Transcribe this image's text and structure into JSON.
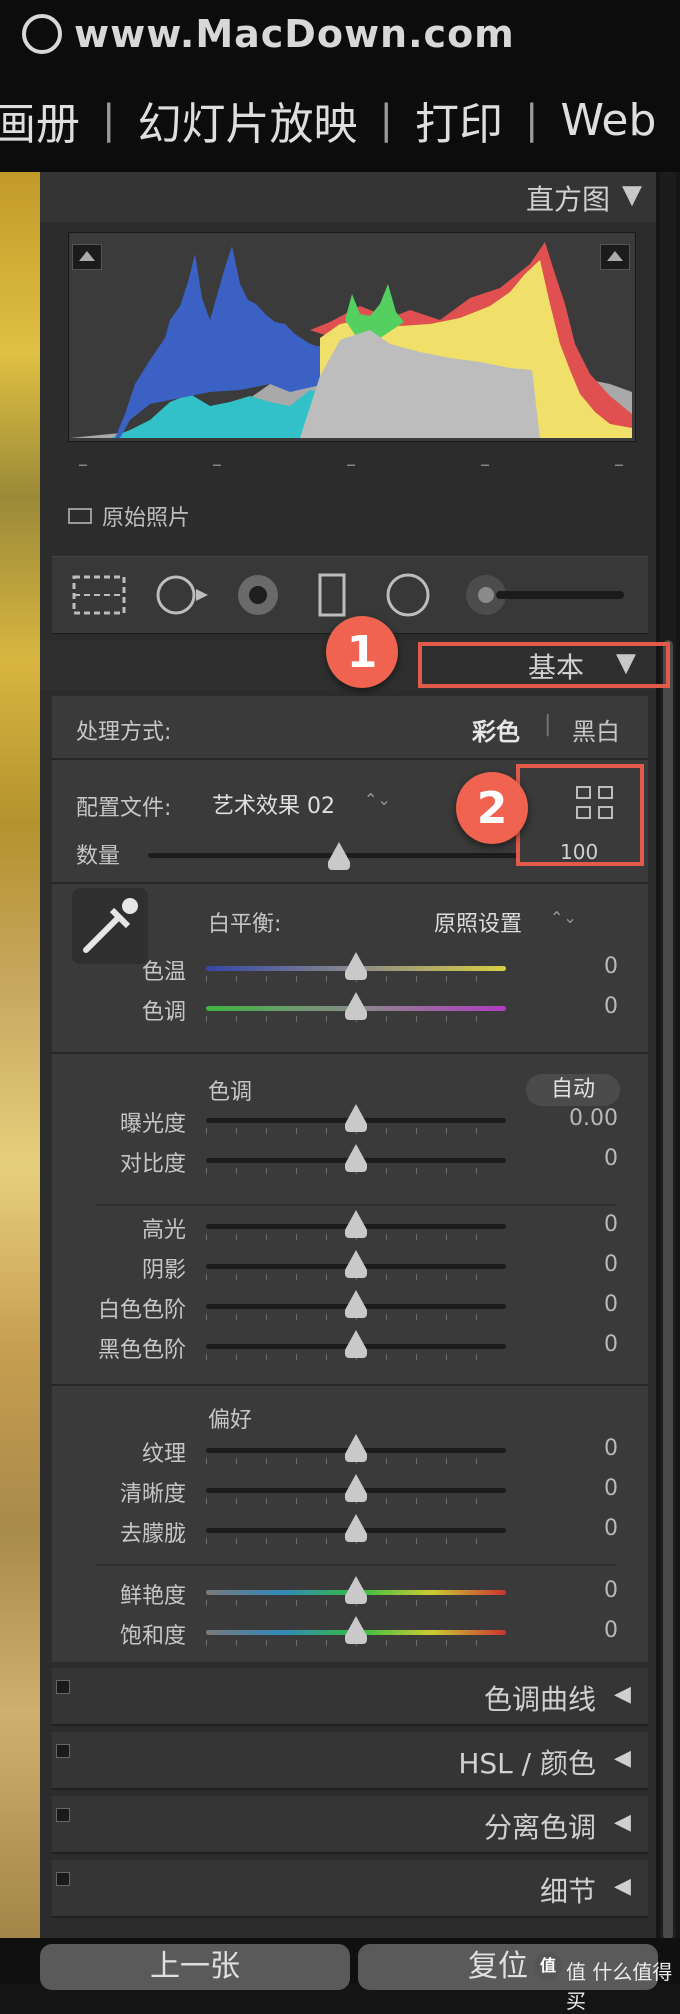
{
  "watermark": {
    "text": "www.MacDown.com"
  },
  "modules": [
    "画册",
    "幻灯片放映",
    "打印",
    "Web"
  ],
  "modules_sep": "|",
  "histogram": {
    "title": "直方图",
    "arrow": "▼",
    "ticks": [
      "–",
      "–",
      "–",
      "–",
      "–"
    ],
    "original_photo_label": "原始照片"
  },
  "tools": [
    "crop-overlay-icon",
    "spot-removal-icon",
    "red-eye-icon",
    "graduated-filter-icon",
    "radial-filter-icon",
    "adjustment-brush-icon"
  ],
  "basic": {
    "title": "基本",
    "arrow": "▼",
    "treatment_label": "处理方式:",
    "treatment_color": "彩色",
    "treatment_sep": "|",
    "treatment_bw": "黑白",
    "profile_label": "配置文件:",
    "profile_value": "艺术效果 02",
    "amount_label": "数量",
    "amount_value": "100",
    "wb_label": "白平衡:",
    "wb_value": "原照设置",
    "stepper": "⌃⌄",
    "tone_title": "色调",
    "auto_label": "自动",
    "presence_title": "偏好"
  },
  "sliders": [
    {
      "label": "色温",
      "value": "0",
      "track": "temp"
    },
    {
      "label": "色调",
      "value": "0",
      "track": "tint"
    },
    {
      "label": "曝光度",
      "value": "0.00",
      "track": "dark"
    },
    {
      "label": "对比度",
      "value": "0",
      "track": "dark"
    },
    {
      "label": "高光",
      "value": "0",
      "track": "dark"
    },
    {
      "label": "阴影",
      "value": "0",
      "track": "dark"
    },
    {
      "label": "白色色阶",
      "value": "0",
      "track": "dark"
    },
    {
      "label": "黑色色阶",
      "value": "0",
      "track": "dark"
    },
    {
      "label": "纹理",
      "value": "0",
      "track": "dark"
    },
    {
      "label": "清晰度",
      "value": "0",
      "track": "dark"
    },
    {
      "label": "去朦胧",
      "value": "0",
      "track": "dark"
    },
    {
      "label": "鲜艳度",
      "value": "0",
      "track": "sat"
    },
    {
      "label": "饱和度",
      "value": "0",
      "track": "sat"
    }
  ],
  "callouts": [
    "1",
    "2"
  ],
  "collapsed_sections": [
    {
      "label": "色调曲线",
      "arrow": "◀"
    },
    {
      "label": "HSL / 颜色",
      "arrow": "◀"
    },
    {
      "label": "分离色调",
      "arrow": "◀"
    },
    {
      "label": "细节",
      "arrow": "◀"
    }
  ],
  "bottom": {
    "prev_label": "上一张",
    "reset_label": "复位",
    "watermark": "值 什么值得买"
  },
  "colors": {
    "highlight": "#e25a4a",
    "callout": "#ef6350",
    "panel": "#3a3a3a"
  }
}
